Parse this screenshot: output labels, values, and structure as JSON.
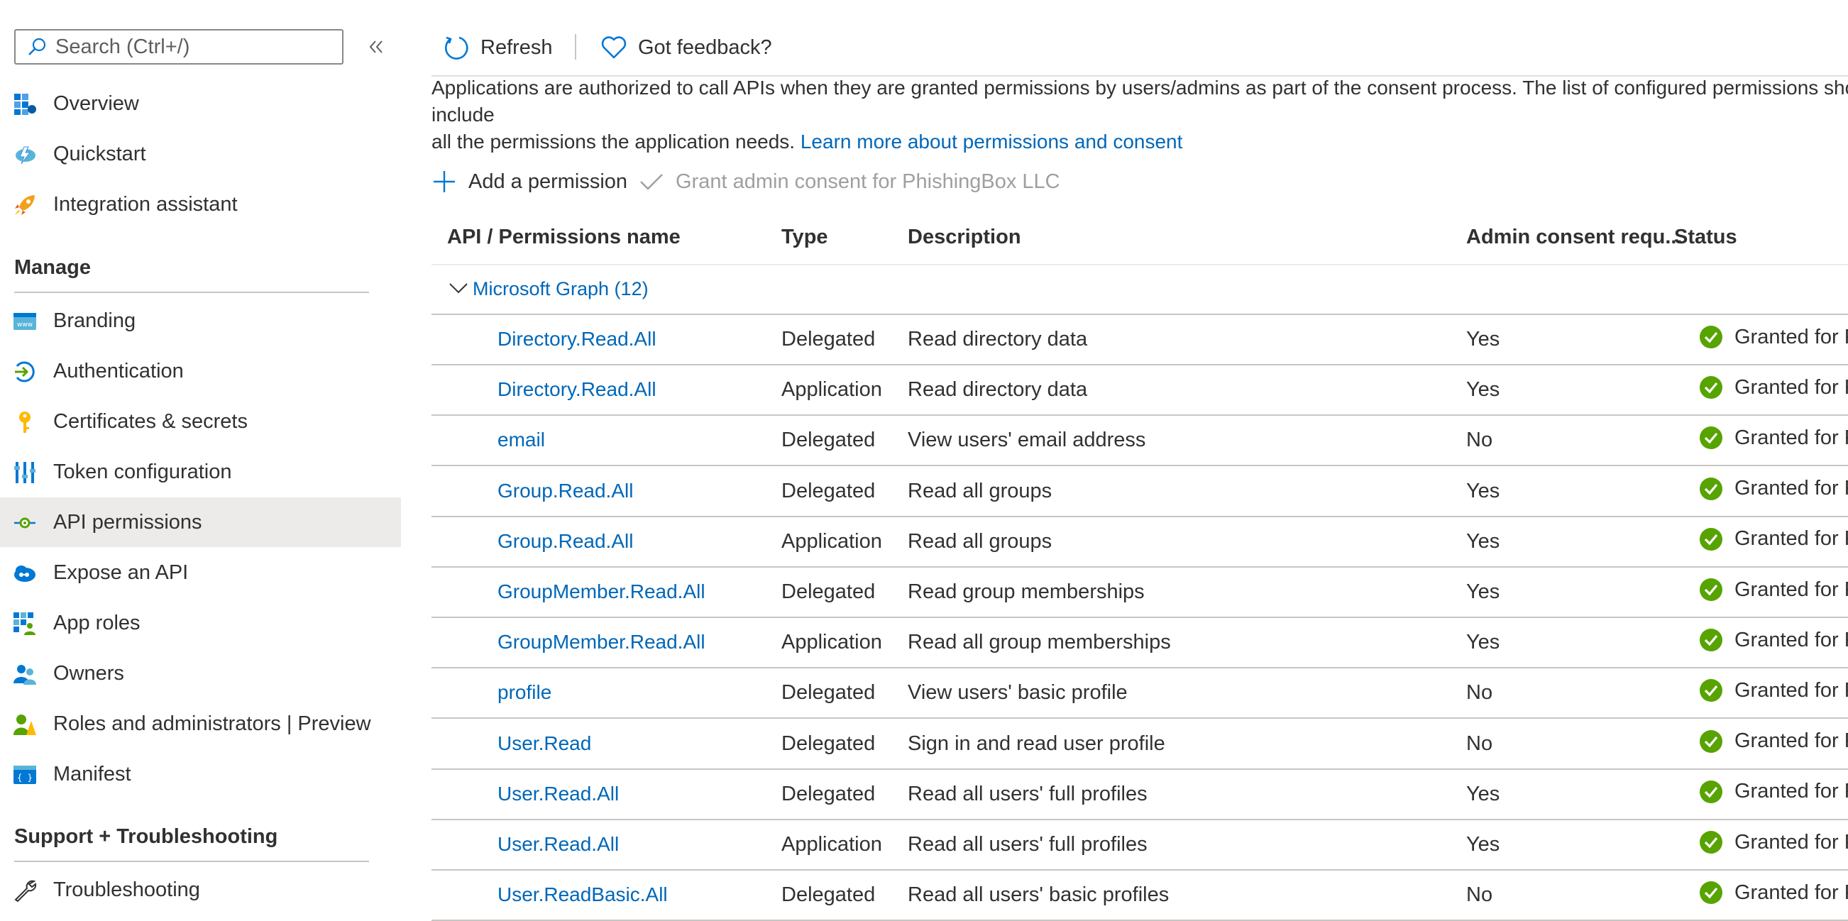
{
  "search": {
    "placeholder": "Search (Ctrl+/)"
  },
  "sidebar": {
    "top_items": [
      {
        "label": "Overview"
      },
      {
        "label": "Quickstart"
      },
      {
        "label": "Integration assistant"
      }
    ],
    "manage_title": "Manage",
    "manage_items": [
      {
        "label": "Branding"
      },
      {
        "label": "Authentication"
      },
      {
        "label": "Certificates & secrets"
      },
      {
        "label": "Token configuration"
      },
      {
        "label": "API permissions"
      },
      {
        "label": "Expose an API"
      },
      {
        "label": "App roles"
      },
      {
        "label": "Owners"
      },
      {
        "label": "Roles and administrators | Preview"
      },
      {
        "label": "Manifest"
      }
    ],
    "support_title": "Support + Troubleshooting",
    "support_items": [
      {
        "label": "Troubleshooting"
      }
    ]
  },
  "toolbar": {
    "refresh_label": "Refresh",
    "feedback_label": "Got feedback?"
  },
  "description": {
    "line1": "Applications are authorized to call APIs when they are granted permissions by users/admins as part of the consent process. The list of configured permissions should include",
    "line2": "all the permissions the application needs. ",
    "link": "Learn more about permissions and consent"
  },
  "actions": {
    "add_permission": "Add a permission",
    "grant_consent": "Grant admin consent for PhishingBox LLC"
  },
  "table": {
    "headers": {
      "name": "API / Permissions name",
      "type": "Type",
      "description": "Description",
      "admin": "Admin consent requ...",
      "status": "Status"
    },
    "group_label": "Microsoft Graph (12)",
    "rows": [
      {
        "name": "Directory.Read.All",
        "type": "Delegated",
        "description": "Read directory data",
        "admin": "Yes",
        "status": "Granted for Ph"
      },
      {
        "name": "Directory.Read.All",
        "type": "Application",
        "description": "Read directory data",
        "admin": "Yes",
        "status": "Granted for Ph"
      },
      {
        "name": "email",
        "type": "Delegated",
        "description": "View users' email address",
        "admin": "No",
        "status": "Granted for Ph"
      },
      {
        "name": "Group.Read.All",
        "type": "Delegated",
        "description": "Read all groups",
        "admin": "Yes",
        "status": "Granted for Ph"
      },
      {
        "name": "Group.Read.All",
        "type": "Application",
        "description": "Read all groups",
        "admin": "Yes",
        "status": "Granted for Ph"
      },
      {
        "name": "GroupMember.Read.All",
        "type": "Delegated",
        "description": "Read group memberships",
        "admin": "Yes",
        "status": "Granted for Ph"
      },
      {
        "name": "GroupMember.Read.All",
        "type": "Application",
        "description": "Read all group memberships",
        "admin": "Yes",
        "status": "Granted for Ph"
      },
      {
        "name": "profile",
        "type": "Delegated",
        "description": "View users' basic profile",
        "admin": "No",
        "status": "Granted for Ph"
      },
      {
        "name": "User.Read",
        "type": "Delegated",
        "description": "Sign in and read user profile",
        "admin": "No",
        "status": "Granted for Ph"
      },
      {
        "name": "User.Read.All",
        "type": "Delegated",
        "description": "Read all users' full profiles",
        "admin": "Yes",
        "status": "Granted for Ph"
      },
      {
        "name": "User.Read.All",
        "type": "Application",
        "description": "Read all users' full profiles",
        "admin": "Yes",
        "status": "Granted for Ph"
      },
      {
        "name": "User.ReadBasic.All",
        "type": "Delegated",
        "description": "Read all users' basic profiles",
        "admin": "No",
        "status": "Granted for Ph"
      }
    ]
  },
  "colors": {
    "link": "#0067b8",
    "granted_green": "#57a300",
    "active_bg": "#edebe9"
  }
}
